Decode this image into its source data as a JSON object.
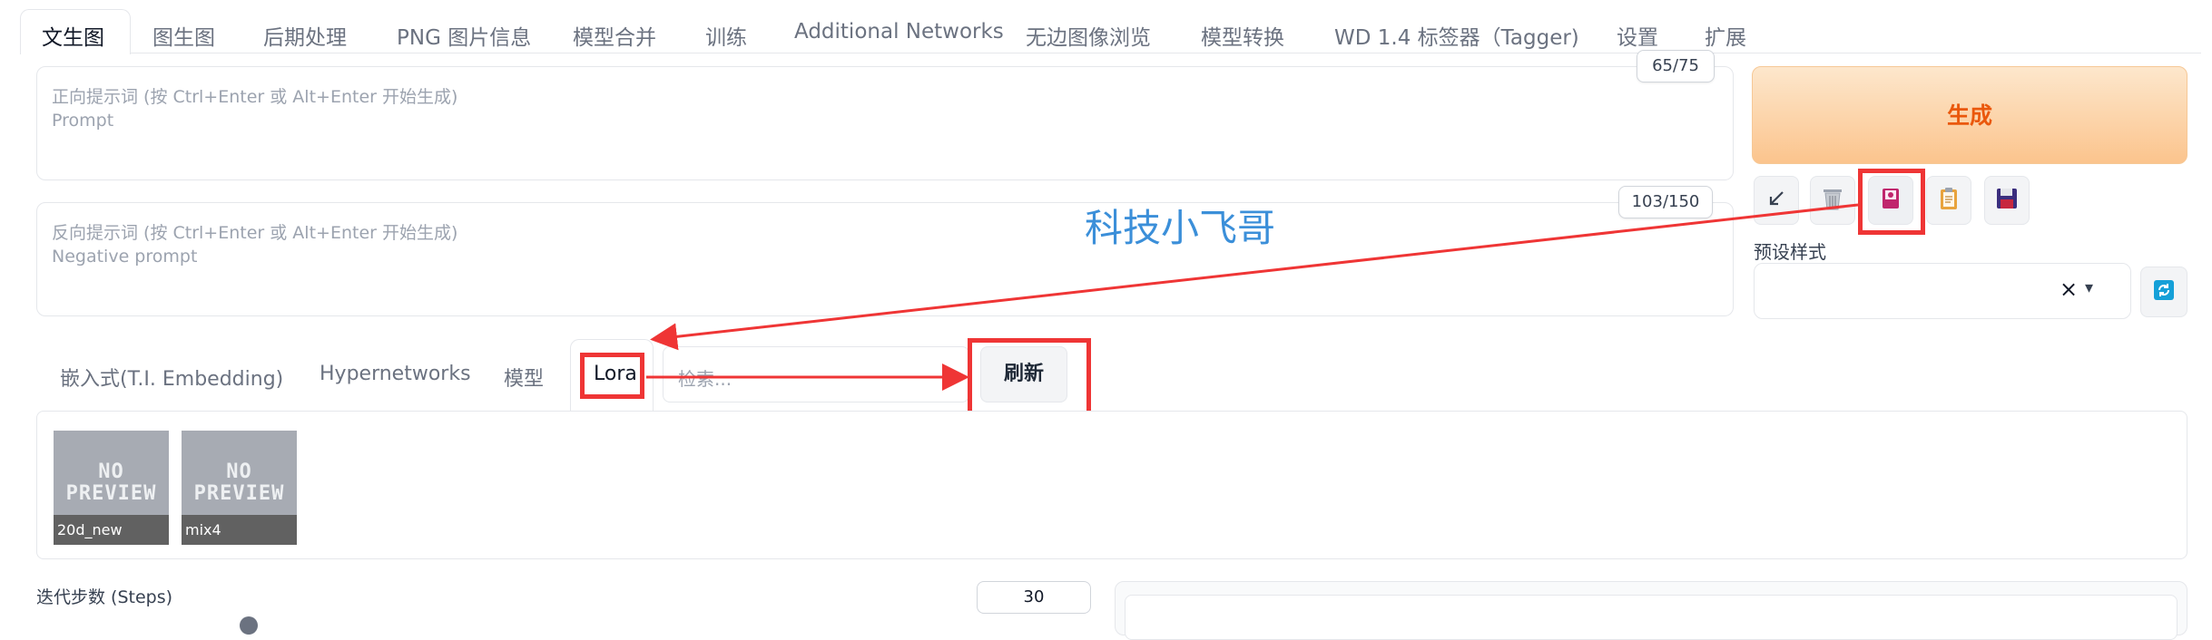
{
  "tabs": [
    "文生图",
    "图生图",
    "后期处理",
    "PNG 图片信息",
    "模型合并",
    "训练",
    "Additional Networks",
    "无边图像浏览",
    "模型转换",
    "WD 1.4 标签器（Tagger)",
    "设置",
    "扩展"
  ],
  "prompt": {
    "placeholder_line1": "正向提示词 (按 Ctrl+Enter 或 Alt+Enter 开始生成)",
    "placeholder_line2": "Prompt",
    "counter": "65/75"
  },
  "negative_prompt": {
    "placeholder_line1": "反向提示词 (按 Ctrl+Enter 或 Alt+Enter 开始生成)",
    "placeholder_line2": "Negative prompt",
    "counter": "103/150"
  },
  "generate_label": "生成",
  "tool_icons": [
    "arrow-icon",
    "trash-icon",
    "extra-networks-icon",
    "clipboard-icon",
    "save-icon"
  ],
  "watermark": "科技小飞哥",
  "styles": {
    "label": "预设样式",
    "clear_symbol": "×",
    "dropdown_symbol": "▾"
  },
  "extra_networks": {
    "tabs": [
      "嵌入式(T.I. Embedding)",
      "Hypernetworks",
      "模型",
      "Lora"
    ],
    "active_tab": "Lora",
    "search_placeholder": "检索...",
    "refresh_label": "刷新",
    "cards": [
      {
        "name": "20d_new",
        "preview_line1": "NO",
        "preview_line2": "PREVIEW"
      },
      {
        "name": "mix4",
        "preview_line1": "NO",
        "preview_line2": "PREVIEW"
      }
    ]
  },
  "steps": {
    "label": "迭代步数 (Steps)",
    "value": "30"
  },
  "colors": {
    "annotation_red": "#ef3535",
    "watermark_blue": "#3b8fd9",
    "generate_orange": "#ea580c"
  }
}
